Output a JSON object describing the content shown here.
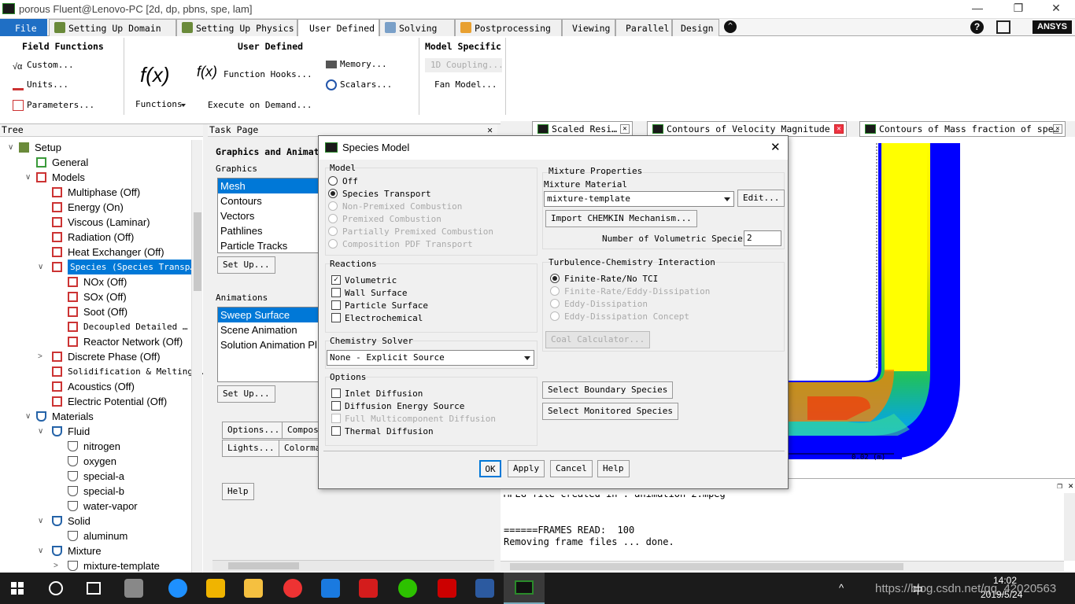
{
  "window": {
    "title": "porous Fluent@Lenovo-PC  [2d, dp, pbns, spe, lam]",
    "min": "—",
    "max": "❐",
    "close": "✕"
  },
  "tabs": [
    {
      "label": "File"
    },
    {
      "label": "Setting Up Domain"
    },
    {
      "label": "Setting Up Physics"
    },
    {
      "label": "User Defined"
    },
    {
      "label": "Solving"
    },
    {
      "label": "Postprocessing"
    },
    {
      "label": "Viewing"
    },
    {
      "label": "Parallel"
    },
    {
      "label": "Design"
    }
  ],
  "brand": "ANSYS",
  "ribbon": {
    "field_functions": {
      "title": "Field Functions",
      "custom": "Custom...",
      "units": "Units...",
      "parameters": "Parameters..."
    },
    "user_defined": {
      "title": "User Defined",
      "functions": "Functions",
      "function_hooks": "Function Hooks...",
      "execute_on_demand": "Execute on Demand...",
      "memory": "Memory...",
      "scalars": "Scalars...",
      "fx": "f(x)"
    },
    "model_specific": {
      "title": "Model Specific",
      "coupling": "1D Coupling...",
      "fan_model": "Fan Model..."
    }
  },
  "tree": {
    "header": "Tree",
    "items": [
      {
        "label": "Setup"
      },
      {
        "label": "General"
      },
      {
        "label": "Models"
      },
      {
        "label": "Multiphase (Off)"
      },
      {
        "label": "Energy (On)"
      },
      {
        "label": "Viscous (Laminar)"
      },
      {
        "label": "Radiation (Off)"
      },
      {
        "label": "Heat Exchanger (Off)"
      },
      {
        "label": "Species (Species Transp…"
      },
      {
        "label": "NOx (Off)"
      },
      {
        "label": "SOx (Off)"
      },
      {
        "label": "Soot (Off)"
      },
      {
        "label": "Decoupled Detailed …"
      },
      {
        "label": "Reactor Network (Off)"
      },
      {
        "label": "Discrete Phase (Off)"
      },
      {
        "label": "Solidification & Melting …"
      },
      {
        "label": "Acoustics (Off)"
      },
      {
        "label": "Electric Potential (Off)"
      },
      {
        "label": "Materials"
      },
      {
        "label": "Fluid"
      },
      {
        "label": "nitrogen"
      },
      {
        "label": "oxygen"
      },
      {
        "label": "special-a"
      },
      {
        "label": "special-b"
      },
      {
        "label": "water-vapor"
      },
      {
        "label": "Solid"
      },
      {
        "label": "aluminum"
      },
      {
        "label": "Mixture"
      },
      {
        "label": "mixture-template"
      }
    ]
  },
  "taskpage": {
    "header": "Task Page",
    "title": "Graphics and Animat",
    "graphics_label": "Graphics",
    "graphics_items": [
      "Mesh",
      "Contours",
      "Vectors",
      "Pathlines",
      "Particle Tracks"
    ],
    "setup1": "Set Up...",
    "animations_label": "Animations",
    "animation_items": [
      "Sweep Surface",
      "Scene Animation",
      "Solution Animation Pl"
    ],
    "setup2": "Set Up...",
    "options": "Options...",
    "compose": "Compose",
    "lights": "Lights...",
    "colormap": "Colormap",
    "help": "Help"
  },
  "gfx_tabs": [
    {
      "label": "Scaled Resi…"
    },
    {
      "label": "Contours of Velocity Magnitude …"
    },
    {
      "label": "Contours of Mass fraction of spe…"
    }
  ],
  "gfx": {
    "scale_label": "0.02 (m)"
  },
  "console": {
    "lines": [
      "MPEG file created in : animation-2.mpeg",
      "",
      "======FRAMES READ:  100",
      "Removing frame files ... done."
    ]
  },
  "dialog": {
    "title": "Species Model",
    "model": {
      "label": "Model",
      "options": [
        "Off",
        "Species Transport",
        "Non-Premixed Combustion",
        "Premixed Combustion",
        "Partially Premixed Combustion",
        "Composition PDF Transport"
      ]
    },
    "reactions": {
      "label": "Reactions",
      "options": [
        "Volumetric",
        "Wall Surface",
        "Particle Surface",
        "Electrochemical"
      ]
    },
    "chemistry_solver": {
      "label": "Chemistry Solver",
      "value": "None - Explicit Source"
    },
    "options": {
      "label": "Options",
      "items": [
        "Inlet Diffusion",
        "Diffusion Energy Source",
        "Full Multicomponent Diffusion",
        "Thermal Diffusion"
      ]
    },
    "mixture": {
      "label": "Mixture Properties",
      "material_label": "Mixture Material",
      "material_value": "mixture-template",
      "edit": "Edit...",
      "import": "Import CHEMKIN Mechanism...",
      "num_species_label": "Number of Volumetric Species",
      "num_species_value": "2"
    },
    "tci": {
      "label": "Turbulence-Chemistry Interaction",
      "options": [
        "Finite-Rate/No TCI",
        "Finite-Rate/Eddy-Dissipation",
        "Eddy-Dissipation",
        "Eddy-Dissipation Concept"
      ],
      "coal": "Coal Calculator..."
    },
    "select_boundary": "Select Boundary Species",
    "select_monitored": "Select Monitored Species",
    "buttons": {
      "ok": "OK",
      "apply": "Apply",
      "cancel": "Cancel",
      "help": "Help"
    }
  },
  "taskbar": {
    "time": "14:02",
    "date": "2019/5/24",
    "watermark": "https://blog.csdn.net/qq_42020563",
    "ime": "中"
  }
}
